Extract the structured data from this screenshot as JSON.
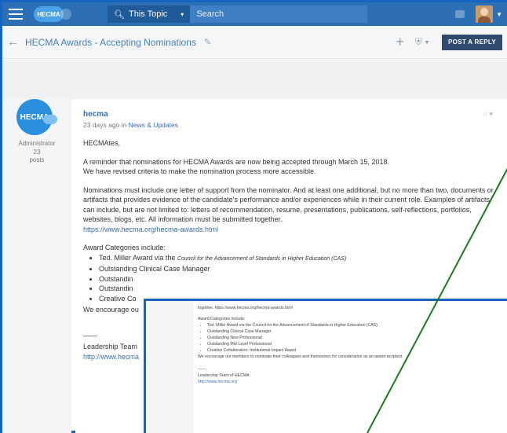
{
  "header": {
    "logo": "HECMA",
    "scope_label": "This Topic",
    "search_placeholder": "Search"
  },
  "topic": {
    "title": "HECMA Awards - Accepting Nominations",
    "reply_button": "POST A REPLY"
  },
  "user": {
    "avatar_text": "HECMA",
    "role": "Administrator",
    "posts_count": "23",
    "posts_label": "posts"
  },
  "post": {
    "author": "hecma",
    "meta_time": "23 days ago in ",
    "meta_category": "News & Updates",
    "greeting": "HECMAtes,",
    "para1_line1": "A reminder that nominations for HECMA Awards are now being accepted through March 15, 2018.",
    "para1_line2": "We have revised criteria to make the nomination process more accessible.",
    "para2": "Nominations must include one letter of support from the nominator. And at least one additional, but no more than two, documents or artifacts that provides evidence of the candidate's performance and/or experiences while in their current role. Examples of artifacts can include, but are not limited to: letters of recommendation, resume, presentations, publications, self-reflections, portfolios, websites, blogs, etc. All information must be submitted together.",
    "link_awards": "https://www.hecma.org/hecma-awards.html",
    "categories_intro": "Award Categories include:",
    "category1_main": "Ted. Miller Award via the ",
    "category1_small": "Council for the Advancement of Standards in Higher Education (CAS)",
    "category2": "Outstanding Clinical Case Manager",
    "category3_partial": "Outstandin",
    "category4_partial": "Outstandin",
    "category5_partial": "Creative Co",
    "encourage_partial": "We encourage ou",
    "sig_dash": "——",
    "sig_team_partial": "Leadership Team",
    "sig_link_partial": "http://www.hecma"
  },
  "zoom": {
    "link_line": "together.  https://www.hecma.org/hecma-awards.html",
    "categories_intro": "Award Categories include:",
    "categories": [
      "Ted. Miller Award via the Council for the Advancement of Standards in Higher Education (CAS)",
      "Outstanding Clinical Case Manager",
      "Outstanding New Professional",
      "Outstanding Mid-Level Professional",
      "Creative Collaboration: Institutional Impact Award"
    ],
    "encourage": "We encourage our members to nominate their colleagues and themselves for consideration as an award recipient.",
    "sig_dash": "——",
    "sig_team": "Leadership Team of HECMA",
    "sig_link": "http://www.hecma.org"
  },
  "colors": {
    "topbar": "#2d6fb5",
    "frame": "#1565c0",
    "annotation_line": "#1b7a1b",
    "reply_button": "#2f4a6e"
  }
}
